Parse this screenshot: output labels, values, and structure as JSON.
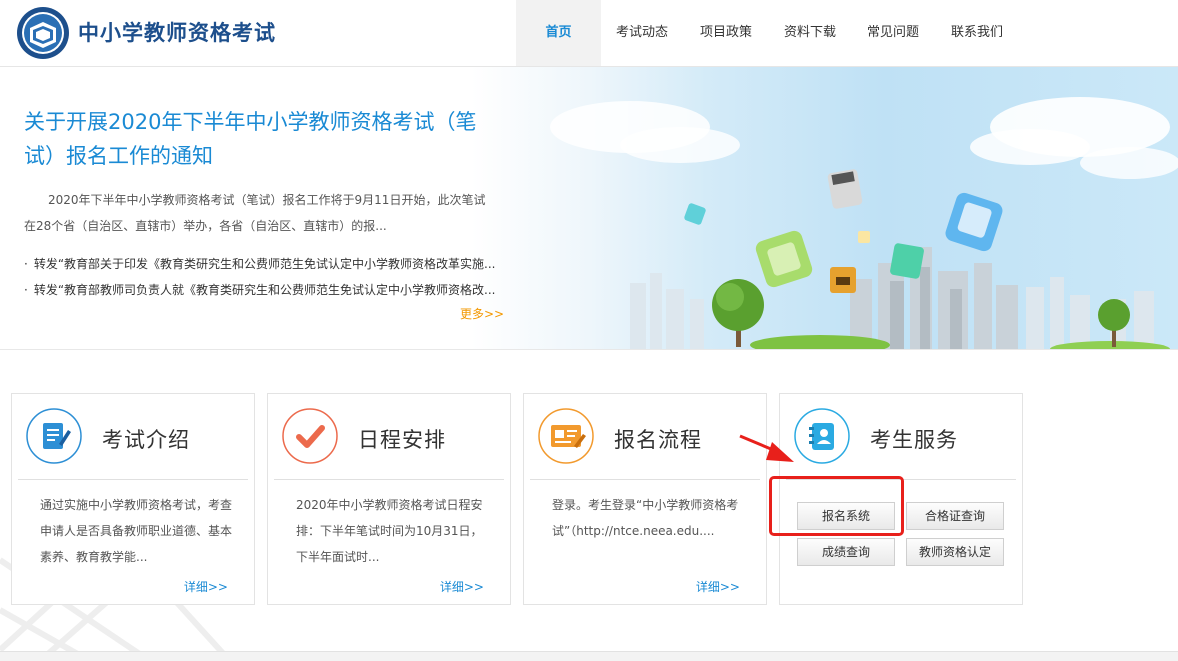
{
  "header": {
    "site_title": "中小学教师资格考试",
    "logo_icon": "book-shield-logo-icon",
    "nav": [
      {
        "label": "首页",
        "active": true
      },
      {
        "label": "考试动态",
        "active": false
      },
      {
        "label": "项目政策",
        "active": false
      },
      {
        "label": "资料下载",
        "active": false
      },
      {
        "label": "常见问题",
        "active": false
      },
      {
        "label": "联系我们",
        "active": false
      }
    ]
  },
  "banner": {
    "title": "关于开展2020年下半年中小学教师资格考试（笔试）报名工作的通知",
    "summary": "2020年下半年中小学教师资格考试（笔试）报名工作将于9月11日开始，此次笔试在28个省（自治区、直辖市）举办，各省（自治区、直辖市）的报...",
    "links": [
      "转发“教育部关于印发《教育类研究生和公费师范生免试认定中小学教师资格改革实施...",
      "转发“教育部教师司负责人就《教育类研究生和公费师范生免试认定中小学教师资格改..."
    ],
    "more": "更多>>"
  },
  "cards": [
    {
      "title": "考试介绍",
      "icon": "document-edit-icon",
      "text": "通过实施中小学教师资格考试，考查申请人是否具备教师职业道德、基本素养、教育教学能...",
      "more": "详细>>"
    },
    {
      "title": "日程安排",
      "icon": "checkmark-icon",
      "text": "2020年中小学教师资格考试日程安排：下半年笔试时间为10月31日，下半年面试时...",
      "more": "详细>>"
    },
    {
      "title": "报名流程",
      "icon": "id-card-edit-icon",
      "text": "登录。考生登录“中小学教师资格考试”（http://ntce.neea.edu....",
      "more": "详细>>"
    }
  ],
  "service": {
    "title": "考生服务",
    "icon": "address-book-icon",
    "buttons": [
      "报名系统",
      "合格证查询",
      "成绩查询",
      "教师资格认定"
    ]
  },
  "colors": {
    "accent_blue": "#1a8ad4",
    "title_navy": "#1d4f8c",
    "more_orange": "#f39800",
    "highlight_red": "#e8201b"
  }
}
